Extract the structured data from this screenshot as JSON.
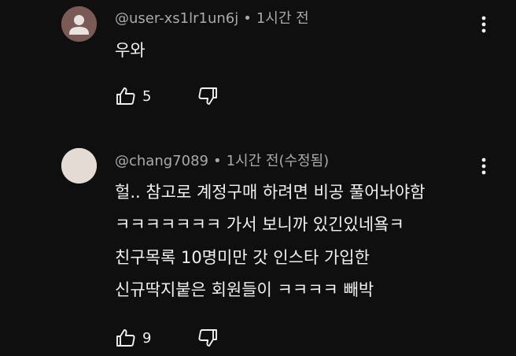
{
  "comments": [
    {
      "author": "@user-xs1lr1un6j",
      "separator": "•",
      "time": "1시간 전",
      "lines": [
        "우와"
      ],
      "likes": "5",
      "avatar_bg": "#7a5a54"
    },
    {
      "author": "@chang7089",
      "separator": "•",
      "time": "1시간 전(수정됨)",
      "lines": [
        "헐.. 참고로 계정구매 하려면 비공 풀어놔야함",
        "ㅋㅋㅋㅋㅋㅋㅋ 가서 보니까 있긴있네욬ㅋ",
        "친구목록 10명미만 갓 인스타 가입한",
        "신규딱지붙은 회원들이 ㅋㅋㅋㅋ 빼박"
      ],
      "likes": "9",
      "avatar_bg": "#e4dcd4"
    }
  ],
  "icons": {
    "like": "thumbs-up-icon",
    "dislike": "thumbs-down-icon",
    "menu": "more-vert-icon"
  },
  "colors": {
    "background": "#0f0f0f",
    "text": "#f1f1f1",
    "secondary": "#aaaaaa"
  }
}
